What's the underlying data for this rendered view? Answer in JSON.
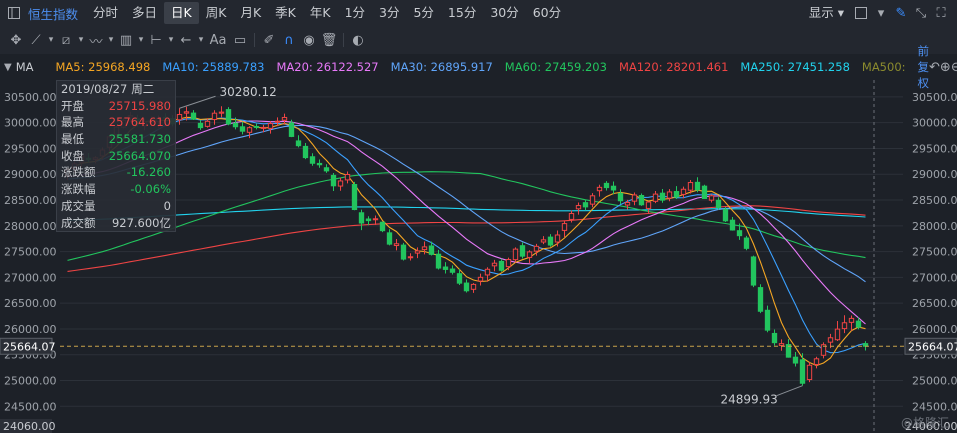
{
  "topbar": {
    "title": "恒生指数",
    "tabs": [
      "分时",
      "多日",
      "日K",
      "周K",
      "月K",
      "季K",
      "年K",
      "1分",
      "3分",
      "5分",
      "15分",
      "30分",
      "60分"
    ],
    "active_tab": "日K",
    "display_label": "显示"
  },
  "toolbar": {
    "text_tool": "Aa"
  },
  "ma_bar": {
    "label": "MA",
    "items": [
      {
        "text": "MA5: 25968.498",
        "color": "#f5a623"
      },
      {
        "text": "MA10: 25889.783",
        "color": "#3aa0ff"
      },
      {
        "text": "MA20: 26122.527",
        "color": "#e879f9"
      },
      {
        "text": "MA30: 26895.917",
        "color": "#60a5fa"
      },
      {
        "text": "MA60: 27459.203",
        "color": "#22c55e"
      },
      {
        "text": "MA120: 28201.461",
        "color": "#ef4444"
      },
      {
        "text": "MA250: 27451.258",
        "color": "#22d3ee"
      },
      {
        "text": "MA500:",
        "color": "#8b8b2e"
      }
    ],
    "adjust_label": "前复权"
  },
  "info_box": {
    "date": "2019/08/27",
    "weekday": "周二",
    "rows": [
      {
        "label": "开盘",
        "value": "25715.980",
        "color": "#ef4444"
      },
      {
        "label": "最高",
        "value": "25764.610",
        "color": "#ef4444"
      },
      {
        "label": "最低",
        "value": "25581.730",
        "color": "#22c55e"
      },
      {
        "label": "收盘",
        "value": "25664.070",
        "color": "#22c55e"
      },
      {
        "label": "涨跌额",
        "value": "-16.260",
        "color": "#22c55e"
      },
      {
        "label": "涨跌幅",
        "value": "-0.06%",
        "color": "#22c55e"
      },
      {
        "label": "成交量",
        "value": "0",
        "color": "#c9ccd1"
      },
      {
        "label": "成交额",
        "value": "927.600亿",
        "color": "#c9ccd1"
      }
    ]
  },
  "watermark": "@格隆汇",
  "chart_data": {
    "type": "candlestick",
    "y_ticks": [
      30500,
      30000,
      29500,
      29000,
      28500,
      28000,
      27500,
      27000,
      26500,
      26000,
      25500,
      25000,
      24500
    ],
    "y_bottom_label": "24060.00",
    "ylim": [
      24060,
      30750
    ],
    "current_price": "25664.07",
    "annotations": [
      {
        "text": "30280.12",
        "index": 16,
        "value": 30280.12
      },
      {
        "text": "24899.93",
        "index": 105,
        "value": 24899.93
      }
    ],
    "candles": [
      [
        28968,
        29121,
        28887,
        29088
      ],
      [
        29112,
        29264,
        29036,
        29202
      ],
      [
        29230,
        29406,
        29138,
        29349
      ],
      [
        29309,
        29411,
        29227,
        29287
      ],
      [
        29287,
        29348,
        29210,
        29319
      ],
      [
        29355,
        29521,
        29281,
        29470
      ],
      [
        29523,
        29771,
        29433,
        29726
      ],
      [
        29769,
        29944,
        29649,
        29912
      ],
      [
        29914,
        30091,
        29890,
        30044
      ],
      [
        30109,
        30212,
        30010,
        30136
      ],
      [
        30074,
        30154,
        29926,
        29972
      ],
      [
        29940,
        30082,
        29854,
        30010
      ],
      [
        30000,
        30118,
        29953,
        30047
      ],
      [
        30025,
        30139,
        29904,
        30081
      ],
      [
        30102,
        30184,
        30016,
        30093
      ],
      [
        30079,
        30146,
        29928,
        29977
      ],
      [
        30057,
        30280,
        29961,
        30158
      ],
      [
        30185,
        30308,
        30042,
        30211
      ],
      [
        30186,
        30243,
        30052,
        30067
      ],
      [
        29987,
        30048,
        29860,
        29904
      ],
      [
        29929,
        30087,
        29903,
        30026
      ],
      [
        30061,
        30241,
        29961,
        30184
      ],
      [
        30184,
        30318,
        30106,
        30205
      ],
      [
        30254,
        30302,
        29949,
        29975
      ],
      [
        29990,
        30100,
        29869,
        29921
      ],
      [
        29920,
        30018,
        29772,
        29835
      ],
      [
        29813,
        29931,
        29701,
        29903
      ],
      [
        29927,
        29982,
        29870,
        29913
      ],
      [
        29897,
        29958,
        29815,
        29908
      ],
      [
        29890,
        30028,
        29788,
        29983
      ],
      [
        30020,
        30103,
        29933,
        30028
      ],
      [
        30048,
        30175,
        29960,
        30101
      ],
      [
        29997,
        30056,
        29719,
        29733
      ],
      [
        29646,
        29757,
        29520,
        29554
      ],
      [
        29540,
        29606,
        29293,
        29323
      ],
      [
        29339,
        29406,
        29164,
        29213
      ],
      [
        29210,
        29286,
        29127,
        29184
      ],
      [
        29126,
        29194,
        29027,
        29065
      ],
      [
        28978,
        29024,
        28674,
        28776
      ],
      [
        28771,
        28933,
        28681,
        28870
      ],
      [
        28890,
        29053,
        28824,
        28995
      ],
      [
        28801,
        28851,
        28302,
        28316
      ],
      [
        28253,
        28315,
        27917,
        28054
      ],
      [
        28132,
        28185,
        28013,
        28101
      ],
      [
        28126,
        28199,
        28018,
        28137
      ],
      [
        28070,
        28083,
        27878,
        27906
      ],
      [
        27864,
        27934,
        27621,
        27645
      ],
      [
        27618,
        27744,
        27523,
        27652
      ],
      [
        27626,
        27669,
        27327,
        27355
      ],
      [
        27396,
        27467,
        27327,
        27400
      ],
      [
        27471,
        27582,
        27374,
        27513
      ],
      [
        27539,
        27695,
        27445,
        27591
      ],
      [
        27609,
        27693,
        27424,
        27446
      ],
      [
        27450,
        27534,
        27152,
        27181
      ],
      [
        27201,
        27295,
        27076,
        27154
      ],
      [
        27162,
        27234,
        27056,
        27099
      ],
      [
        27072,
        27159,
        26853,
        26888
      ],
      [
        26890,
        26961,
        26707,
        26740
      ],
      [
        26769,
        26888,
        26700,
        26864
      ],
      [
        26929,
        27073,
        26843,
        27001
      ],
      [
        27047,
        27196,
        26916,
        27157
      ],
      [
        27224,
        27339,
        27118,
        27275
      ],
      [
        27310,
        27361,
        27110,
        27138
      ],
      [
        27209,
        27384,
        27141,
        27346
      ],
      [
        27344,
        27583,
        27291,
        27548
      ],
      [
        27615,
        27677,
        27367,
        27412
      ],
      [
        27387,
        27525,
        27276,
        27494
      ],
      [
        27509,
        27651,
        27423,
        27602
      ],
      [
        27686,
        27800,
        27645,
        27728
      ],
      [
        27781,
        27840,
        27595,
        27627
      ],
      [
        27686,
        27908,
        27598,
        27822
      ],
      [
        27911,
        28093,
        27781,
        28043
      ],
      [
        28124,
        28298,
        28064,
        28238
      ],
      [
        28330,
        28451,
        28216,
        28393
      ],
      [
        28449,
        28497,
        28300,
        28367
      ],
      [
        28420,
        28635,
        28360,
        28582
      ],
      [
        28681,
        28796,
        28567,
        28746
      ],
      [
        28823,
        28867,
        28684,
        28741
      ],
      [
        28768,
        28860,
        28611,
        28695
      ],
      [
        28631,
        28710,
        28424,
        28486
      ],
      [
        28403,
        28502,
        28319,
        28452
      ],
      [
        28478,
        28647,
        28400,
        28598
      ],
      [
        28588,
        28626,
        28386,
        28408
      ],
      [
        28337,
        28479,
        28238,
        28462
      ],
      [
        28475,
        28675,
        28441,
        28615
      ],
      [
        28633,
        28713,
        28447,
        28498
      ],
      [
        28537,
        28712,
        28476,
        28657
      ],
      [
        28665,
        28769,
        28520,
        28559
      ],
      [
        28609,
        28760,
        28535,
        28709
      ],
      [
        28691,
        28889,
        28626,
        28839
      ],
      [
        28843,
        28941,
        28651,
        28697
      ],
      [
        28769,
        28797,
        28526,
        28530
      ],
      [
        28497,
        28613,
        28451,
        28582
      ],
      [
        28495,
        28554,
        28311,
        28355
      ],
      [
        28320,
        28366,
        28075,
        28097
      ],
      [
        28109,
        28172,
        27906,
        27919
      ],
      [
        27906,
        28046,
        27728,
        27809
      ],
      [
        27763,
        27805,
        27525,
        27563
      ],
      [
        27396,
        27423,
        26812,
        26851
      ],
      [
        26802,
        26867,
        26306,
        26343
      ],
      [
        26362,
        26452,
        25937,
        25977
      ],
      [
        25913,
        25989,
        25680,
        25734
      ],
      [
        25680,
        25797,
        25577,
        25715
      ],
      [
        25698,
        25802,
        25443,
        25453
      ],
      [
        25453,
        25554,
        25271,
        25339
      ],
      [
        25401,
        25531,
        24900,
        24947
      ],
      [
        25019,
        25352,
        24970,
        25296
      ],
      [
        25311,
        25460,
        25235,
        25421
      ],
      [
        25490,
        25740,
        25429,
        25694
      ],
      [
        25744,
        25904,
        25629,
        25829
      ],
      [
        25791,
        26155,
        25766,
        25997
      ],
      [
        26007,
        26265,
        25920,
        26120
      ],
      [
        26128,
        26262,
        25964,
        26205
      ],
      [
        26152,
        26224,
        25992,
        26036
      ],
      [
        25716,
        25765,
        25582,
        25664
      ]
    ]
  }
}
